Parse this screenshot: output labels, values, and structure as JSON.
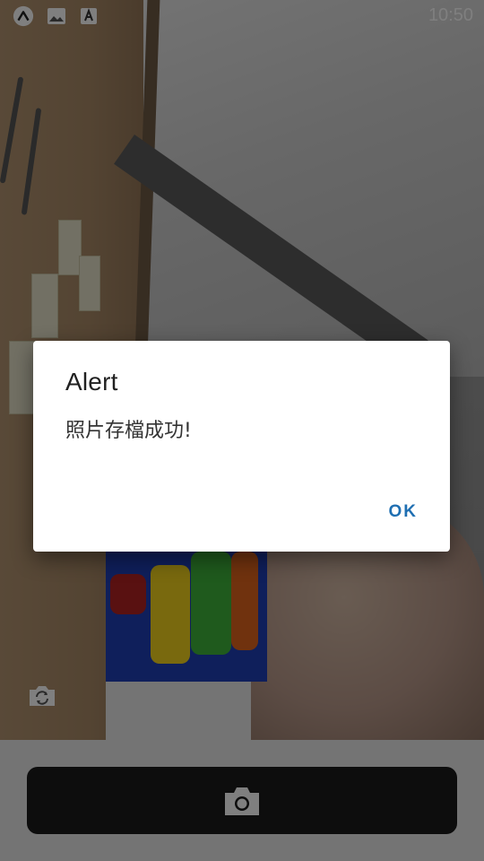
{
  "status_bar": {
    "time": "10:50",
    "icons": [
      "expo-go-icon",
      "image-icon",
      "font-icon"
    ]
  },
  "camera": {
    "switch_icon": "camera-switch-icon"
  },
  "capture": {
    "icon": "camera-icon"
  },
  "alert": {
    "title": "Alert",
    "message": "照片存檔成功!",
    "ok_label": "OK"
  },
  "colors": {
    "accent": "#1f6fb2",
    "panel": "#e9e9e9",
    "capture_button": "#1b1b1b"
  }
}
